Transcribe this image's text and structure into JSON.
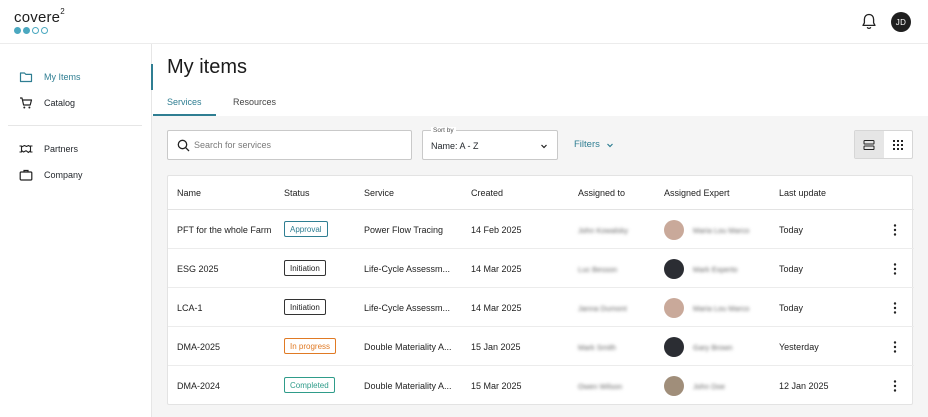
{
  "app": {
    "logo_text": "covere",
    "logo_sup": "2"
  },
  "user": {
    "initials": "JD"
  },
  "sidebar": {
    "items": [
      {
        "label": "My Items",
        "icon": "folder-icon",
        "active": true
      },
      {
        "label": "Catalog",
        "icon": "cart-icon",
        "active": false
      },
      {
        "label": "Partners",
        "icon": "handshake-icon",
        "active": false
      },
      {
        "label": "Company",
        "icon": "briefcase-icon",
        "active": false
      }
    ]
  },
  "page": {
    "title": "My items"
  },
  "tabs": [
    {
      "label": "Services",
      "active": true
    },
    {
      "label": "Resources",
      "active": false
    }
  ],
  "toolbar": {
    "search_placeholder": "Search for services",
    "sort_caption": "Sort by",
    "sort_value": "Name: A - Z",
    "filters_label": "Filters"
  },
  "table": {
    "headers": [
      "Name",
      "Status",
      "Service",
      "Created",
      "Assigned to",
      "Assigned Expert",
      "Last update"
    ],
    "rows": [
      {
        "name": "PFT for the whole Farm",
        "status": "Approval",
        "status_type": "approval",
        "service": "Power Flow Tracing",
        "created": "14 Feb 2025",
        "assigned_to": "John Kowalsky",
        "expert": "Maria Lou Marco",
        "last_update": "Today"
      },
      {
        "name": "ESG 2025",
        "status": "Initiation",
        "status_type": "initiation",
        "service": "Life-Cycle Assessm...",
        "created": "14 Mar 2025",
        "assigned_to": "Luc Besson",
        "expert": "Mark Experto",
        "last_update": "Today"
      },
      {
        "name": "LCA-1",
        "status": "Initiation",
        "status_type": "initiation",
        "service": "Life-Cycle Assessm...",
        "created": "14 Mar 2025",
        "assigned_to": "Janna Dumont",
        "expert": "Maria Lou Marco",
        "last_update": "Today"
      },
      {
        "name": "DMA-2025",
        "status": "In progress",
        "status_type": "progress",
        "service": "Double Materiality A...",
        "created": "15 Jan 2025",
        "assigned_to": "Mark Smith",
        "expert": "Gary Brown",
        "last_update": "Yesterday"
      },
      {
        "name": "DMA-2024",
        "status": "Completed",
        "status_type": "completed",
        "service": "Double Materiality A...",
        "created": "15 Mar 2025",
        "assigned_to": "Owen Wilson",
        "expert": "John Doe",
        "last_update": "12 Jan 2025"
      }
    ]
  },
  "colors": {
    "accent": "#2f7e92",
    "in_progress": "#e07a24",
    "completed": "#2f9c8a",
    "content_bg": "#f5f5f5"
  }
}
